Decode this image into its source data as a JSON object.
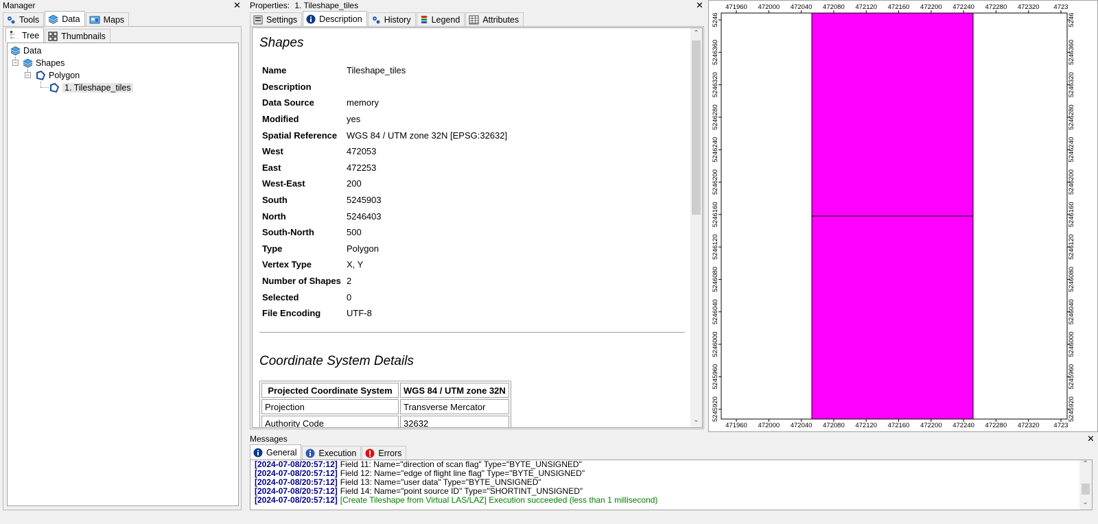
{
  "manager": {
    "title": "Manager",
    "tabs": [
      {
        "label": "Tools"
      },
      {
        "label": "Data"
      },
      {
        "label": "Maps"
      }
    ],
    "subtabs": [
      {
        "label": "Tree"
      },
      {
        "label": "Thumbnails"
      }
    ],
    "tree": [
      {
        "label": "Data",
        "icon": "layers-icon"
      },
      {
        "label": "Shapes",
        "icon": "layers-icon"
      },
      {
        "label": "Polygon",
        "icon": "polygon-icon"
      },
      {
        "label": "1. Tileshape_tiles",
        "icon": "polygon-icon"
      }
    ]
  },
  "properties": {
    "title": "Properties:",
    "subject": "1. Tileshape_tiles",
    "tabs": [
      {
        "label": "Settings"
      },
      {
        "label": "Description"
      },
      {
        "label": "History"
      },
      {
        "label": "Legend"
      },
      {
        "label": "Attributes"
      }
    ],
    "section_title": "Shapes",
    "rows": [
      {
        "key": "Name",
        "value": "Tileshape_tiles"
      },
      {
        "key": "Description",
        "value": ""
      },
      {
        "key": "Data Source",
        "value": "memory"
      },
      {
        "key": "Modified",
        "value": "yes"
      },
      {
        "key": "Spatial Reference",
        "value": "WGS 84 / UTM zone 32N [EPSG:32632]"
      },
      {
        "key": "West",
        "value": "472053"
      },
      {
        "key": "East",
        "value": "472253"
      },
      {
        "key": "West-East",
        "value": "200"
      },
      {
        "key": "South",
        "value": "5245903"
      },
      {
        "key": "North",
        "value": "5246403"
      },
      {
        "key": "South-North",
        "value": "500"
      },
      {
        "key": "Type",
        "value": "Polygon"
      },
      {
        "key": "Vertex Type",
        "value": "X, Y"
      },
      {
        "key": "Number of Shapes",
        "value": "2"
      },
      {
        "key": "Selected",
        "value": "0"
      },
      {
        "key": "File Encoding",
        "value": "UTF-8"
      }
    ],
    "cs_title": "Coordinate System Details",
    "cs_table": {
      "header": [
        "Projected Coordinate System",
        "WGS 84 / UTM zone 32N"
      ],
      "rows": [
        [
          "Projection",
          "Transverse Mercator"
        ],
        [
          "Authority Code",
          "32632"
        ]
      ]
    }
  },
  "map": {
    "x_ticks": [
      "471960",
      "472000",
      "472040",
      "472080",
      "472120",
      "472160",
      "472200",
      "472240",
      "472280",
      "472320",
      "4723"
    ],
    "y_ticks": [
      "5246",
      "5246360",
      "5246320",
      "5246280",
      "5246240",
      "5246200",
      "5246160",
      "5246120",
      "5246080",
      "5246040",
      "5246000",
      "5245960",
      "5245920"
    ],
    "fill_color": "#ff00ff",
    "tiles": 2
  },
  "messages": {
    "title": "Messages",
    "tabs": [
      {
        "label": "General"
      },
      {
        "label": "Execution"
      },
      {
        "label": "Errors"
      }
    ],
    "lines": [
      {
        "ts": "[2024-07-08/20:57:12]",
        "text": "Field 11: Name=\"direction of scan flag\" Type=\"BYTE_UNSIGNED\""
      },
      {
        "ts": "[2024-07-08/20:57:12]",
        "text": "Field 12: Name=\"edge of flight line flag\" Type=\"BYTE_UNSIGNED\""
      },
      {
        "ts": "[2024-07-08/20:57:12]",
        "text": "Field 13: Name=\"user data\" Type=\"BYTE_UNSIGNED\""
      },
      {
        "ts": "[2024-07-08/20:57:12]",
        "text": "Field 14: Name=\"point source ID\" Type=\"SHORTINT_UNSIGNED\""
      },
      {
        "ts": "[2024-07-08/20:57:12]",
        "text": "[Create Tileshape from Virtual LAS/LAZ] Execution succeeded (less than 1 millisecond)"
      }
    ]
  },
  "colors": {
    "accent": "#00008b",
    "success": "#008000",
    "map_fill": "#ff00ff"
  }
}
